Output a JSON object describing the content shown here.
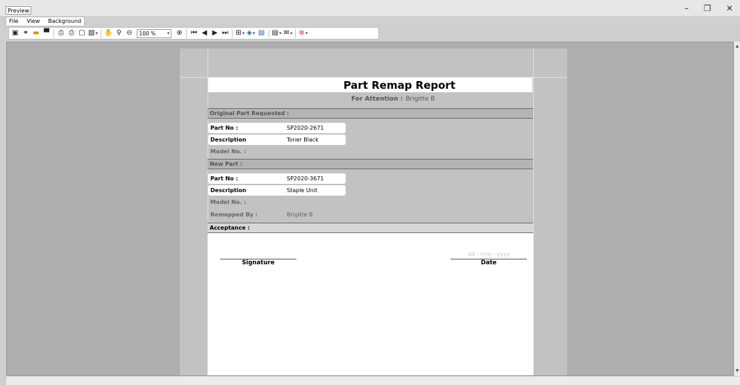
{
  "window": {
    "title": "Preview",
    "minimize": "–",
    "restore": "❐",
    "close": "✕"
  },
  "menu": [
    "File",
    "View",
    "Background"
  ],
  "toolbar": {
    "zoom_value": "100 %",
    "icons": {
      "toggle_pane": "▣",
      "find": "⚭",
      "open": "▬",
      "save": "▀",
      "print": "⎙",
      "quick_print": "⎙",
      "page_setup": "▢",
      "scale": "▧",
      "hand": "✋",
      "magnifier": "⚲",
      "zoom_out": "⊖",
      "zoom_in": "⊕",
      "first_page": "⏮",
      "prev_page": "◀",
      "next_page": "▶",
      "last_page": "⏭",
      "multi_page": "⊞",
      "background": "◈",
      "watermark": "▤",
      "export": "▤",
      "email": "✉",
      "close_preview": "⊗"
    }
  },
  "report": {
    "title": "Part Remap Report",
    "attention_label": "For Attention :",
    "attention_value": "Brigitte B",
    "original": {
      "header": "Original Part Requested :",
      "part_no_label": "Part No :",
      "part_no": "SP2020-2671",
      "description_label": "Description",
      "description": "Toner Black",
      "model_label": "Model No. :"
    },
    "new_part": {
      "header": "New Part :",
      "part_no_label": "Part No :",
      "part_no": "SP2020-3671",
      "description_label": "Description",
      "description": "Staple Unit",
      "model_label": "Model No. :",
      "remapped_label": "Remapped By :",
      "remapped_value": "Brigitte B"
    },
    "acceptance": {
      "header": "Acceptance :",
      "signature_label": "Signature",
      "date_placeholder": "dd - mm - yyyy",
      "date_label": "Date"
    }
  }
}
